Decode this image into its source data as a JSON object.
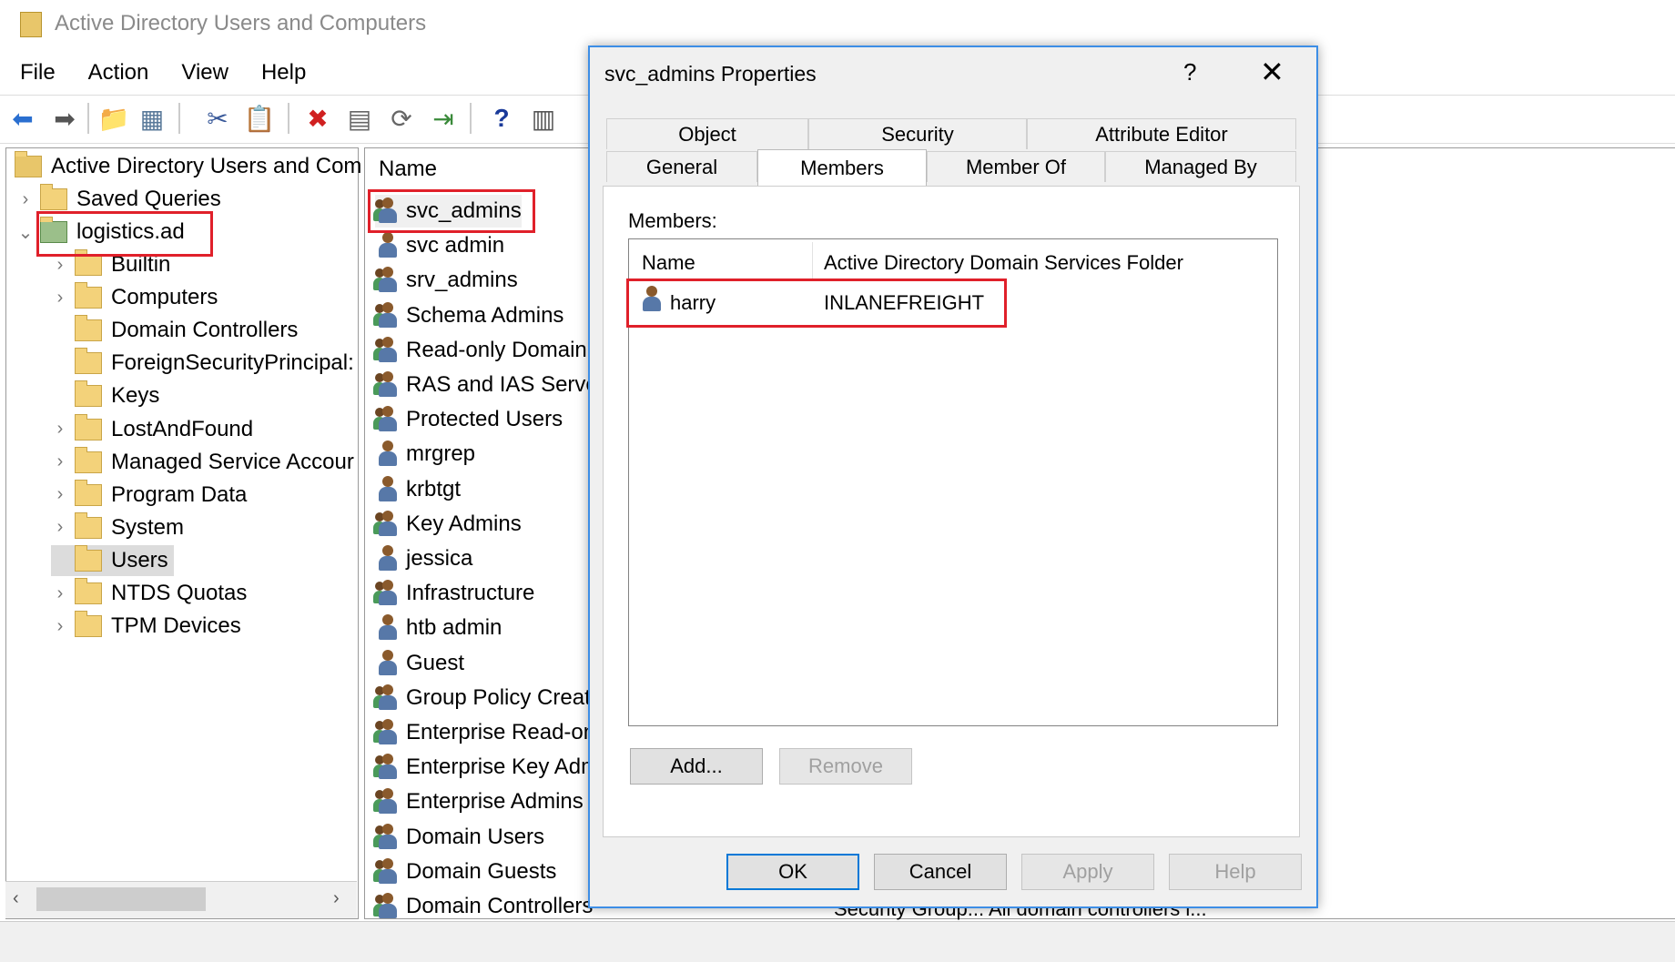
{
  "window": {
    "title": "Active Directory Users and Computers"
  },
  "menu": [
    "File",
    "Action",
    "View",
    "Help"
  ],
  "tree": {
    "root": "Active Directory Users and Com",
    "saved_queries": "Saved Queries",
    "domain": "logistics.ad",
    "containers": [
      {
        "label": "Builtin",
        "arrow": "›"
      },
      {
        "label": "Computers",
        "arrow": "›"
      },
      {
        "label": "Domain Controllers",
        "arrow": ""
      },
      {
        "label": "ForeignSecurityPrincipal:",
        "arrow": ""
      },
      {
        "label": "Keys",
        "arrow": ""
      },
      {
        "label": "LostAndFound",
        "arrow": "›"
      },
      {
        "label": "Managed Service Accour",
        "arrow": "›"
      },
      {
        "label": "Program Data",
        "arrow": "›"
      },
      {
        "label": "System",
        "arrow": "›"
      },
      {
        "label": "Users",
        "arrow": ""
      },
      {
        "label": "NTDS Quotas",
        "arrow": "›"
      },
      {
        "label": "TPM Devices",
        "arrow": "›"
      }
    ]
  },
  "list": {
    "header": "Name",
    "items": [
      {
        "name": "svc_admins",
        "type": "group"
      },
      {
        "name": "svc admin",
        "type": "user"
      },
      {
        "name": "srv_admins",
        "type": "group"
      },
      {
        "name": "Schema Admins",
        "type": "group"
      },
      {
        "name": "Read-only Domain",
        "type": "group"
      },
      {
        "name": "RAS and IAS Server",
        "type": "group"
      },
      {
        "name": "Protected Users",
        "type": "group"
      },
      {
        "name": "mrgrep",
        "type": "user"
      },
      {
        "name": "krbtgt",
        "type": "user"
      },
      {
        "name": "Key Admins",
        "type": "group"
      },
      {
        "name": "jessica",
        "type": "user"
      },
      {
        "name": "Infrastructure",
        "type": "group"
      },
      {
        "name": "htb admin",
        "type": "user"
      },
      {
        "name": "Guest",
        "type": "user"
      },
      {
        "name": "Group Policy Creat",
        "type": "group"
      },
      {
        "name": "Enterprise Read-on",
        "type": "group"
      },
      {
        "name": "Enterprise Key Adm",
        "type": "group"
      },
      {
        "name": "Enterprise Admins",
        "type": "group"
      },
      {
        "name": "Domain Users",
        "type": "group"
      },
      {
        "name": "Domain Guests",
        "type": "group"
      },
      {
        "name": "Domain Controllers",
        "type": "group"
      }
    ],
    "bottom_text": "Security Group...    All domain controllers i..."
  },
  "dialog": {
    "title": "svc_admins Properties",
    "help": "?",
    "close": "✕",
    "tabs_row1": [
      "Object",
      "Security",
      "Attribute Editor"
    ],
    "tabs_row2": [
      "General",
      "Members",
      "Member Of",
      "Managed By"
    ],
    "active_tab": "Members",
    "members_label": "Members:",
    "columns": [
      "Name",
      "Active Directory Domain Services Folder"
    ],
    "members": [
      {
        "name": "harry",
        "folder": "INLANEFREIGHT"
      }
    ],
    "add_button": "Add...",
    "remove_button": "Remove",
    "ok_button": "OK",
    "cancel_button": "Cancel",
    "apply_button": "Apply",
    "help_button": "Help"
  },
  "colors": {
    "accent": "#0078d7",
    "highlight": "#e0202a"
  }
}
